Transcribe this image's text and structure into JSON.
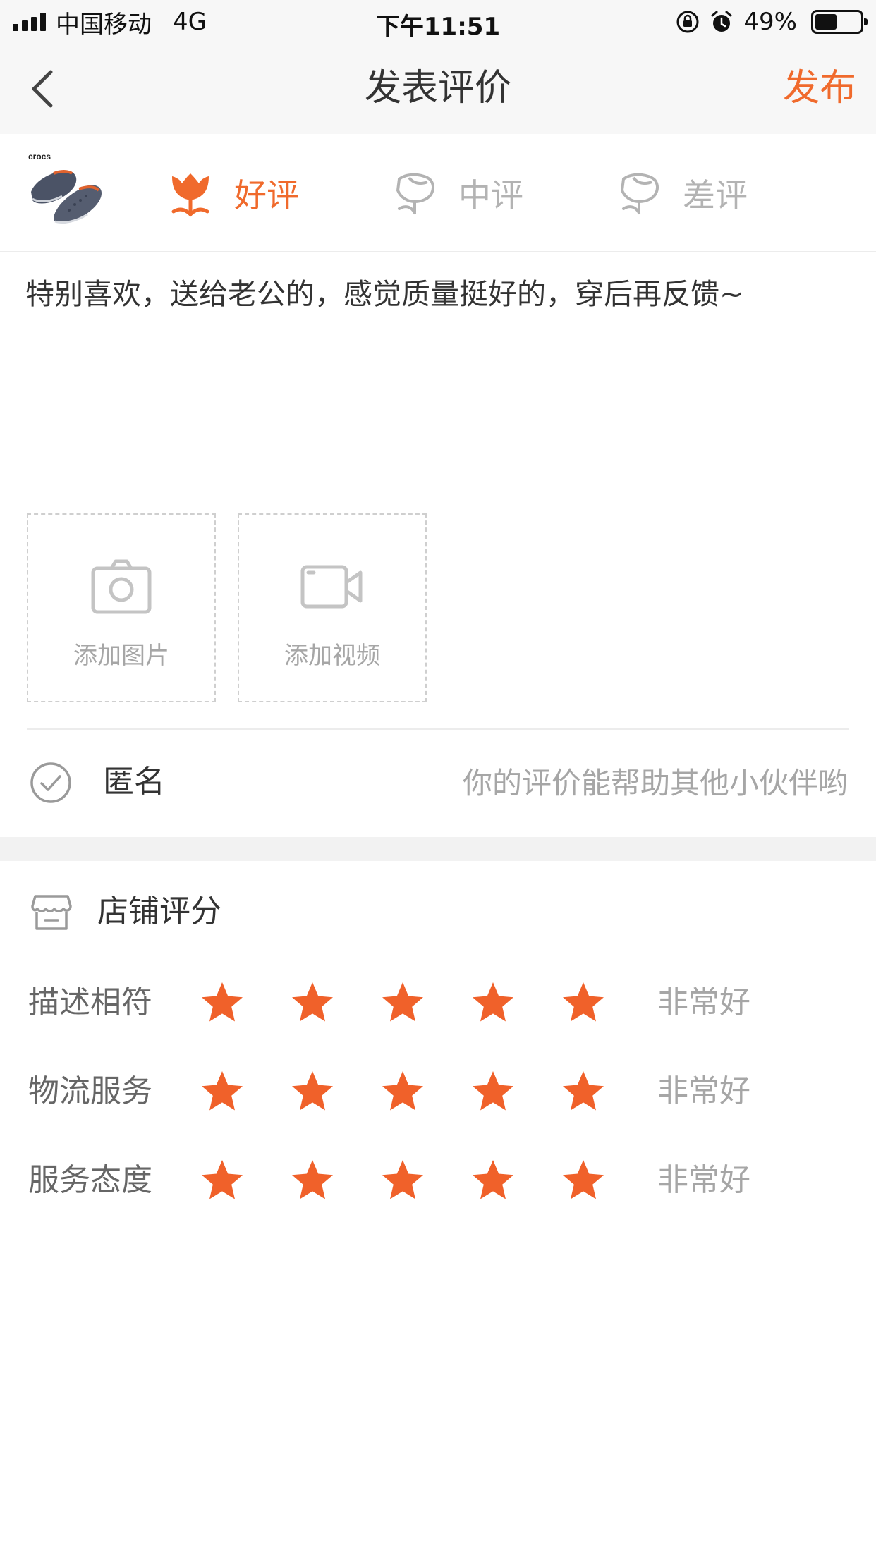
{
  "status_bar": {
    "carrier": "中国移动",
    "network": "4G",
    "time": "下午11:51",
    "battery_percent": "49%",
    "battery_level": 0.49
  },
  "nav": {
    "title": "发表评价",
    "publish_label": "发布",
    "back_icon": "chevron-left-icon"
  },
  "product": {
    "brand_mark": "crocs"
  },
  "rating_options": [
    {
      "label": "好评",
      "icon": "flower-icon",
      "selected": true
    },
    {
      "label": "中评",
      "icon": "flower-outline-icon",
      "selected": false
    },
    {
      "label": "差评",
      "icon": "flower-outline-icon",
      "selected": false
    }
  ],
  "comment": {
    "text": "特别喜欢，送给老公的，感觉质量挺好的，穿后再反馈~"
  },
  "media": {
    "add_photo_label": "添加图片",
    "add_video_label": "添加视频"
  },
  "anonymous": {
    "label": "匿名",
    "hint": "你的评价能帮助其他小伙伴哟"
  },
  "shop_rating": {
    "title": "店铺评分",
    "rows": [
      {
        "name": "描述相符",
        "stars": 5,
        "max": 5,
        "level": "非常好"
      },
      {
        "name": "物流服务",
        "stars": 5,
        "max": 5,
        "level": "非常好"
      },
      {
        "name": "服务态度",
        "stars": 5,
        "max": 5,
        "level": "非常好"
      }
    ]
  },
  "colors": {
    "accent": "#f06a2c",
    "star": "#f0612a",
    "muted_text": "#a6a6a6",
    "nav_background": "#f7f7f7"
  }
}
